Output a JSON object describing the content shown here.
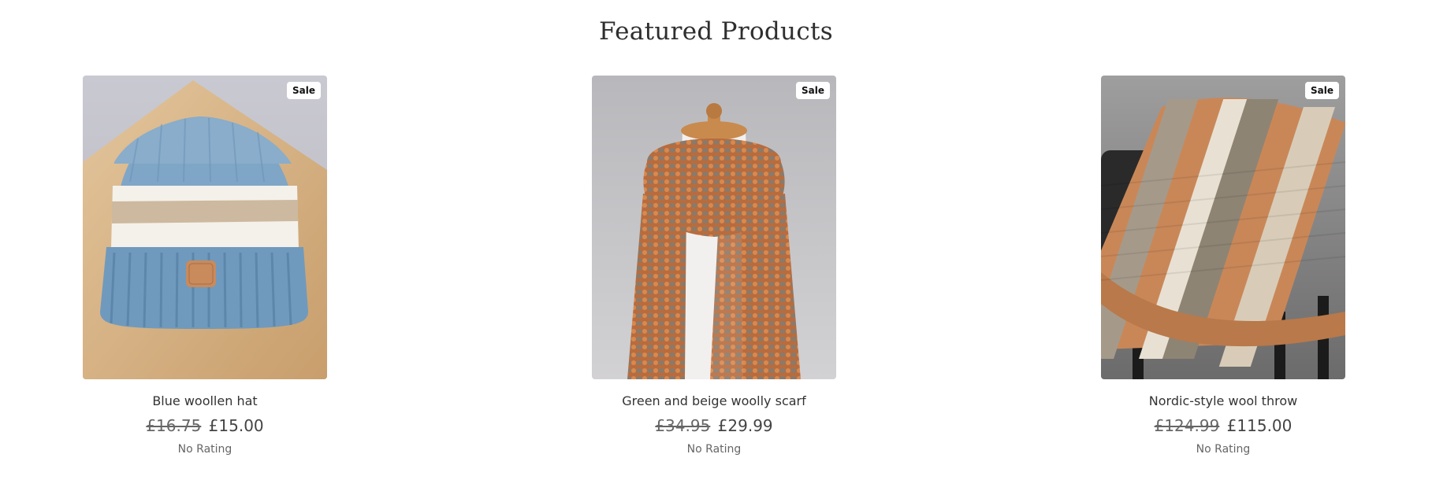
{
  "section": {
    "title": "Featured Products"
  },
  "products": [
    {
      "name": "Blue woollen hat",
      "badge": "Sale",
      "old_price": "£16.75",
      "price": "£15.00",
      "rating": "No Rating",
      "image": "blue-white-striped-beanie"
    },
    {
      "name": "Green and beige woolly scarf",
      "badge": "Sale",
      "old_price": "£34.95",
      "price": "£29.99",
      "rating": "No Rating",
      "image": "knitted-scarf-on-mannequin"
    },
    {
      "name": "Nordic-style wool throw",
      "badge": "Sale",
      "old_price": "£124.99",
      "price": "£115.00",
      "rating": "No Rating",
      "image": "striped-wool-throw-on-chair"
    }
  ]
}
